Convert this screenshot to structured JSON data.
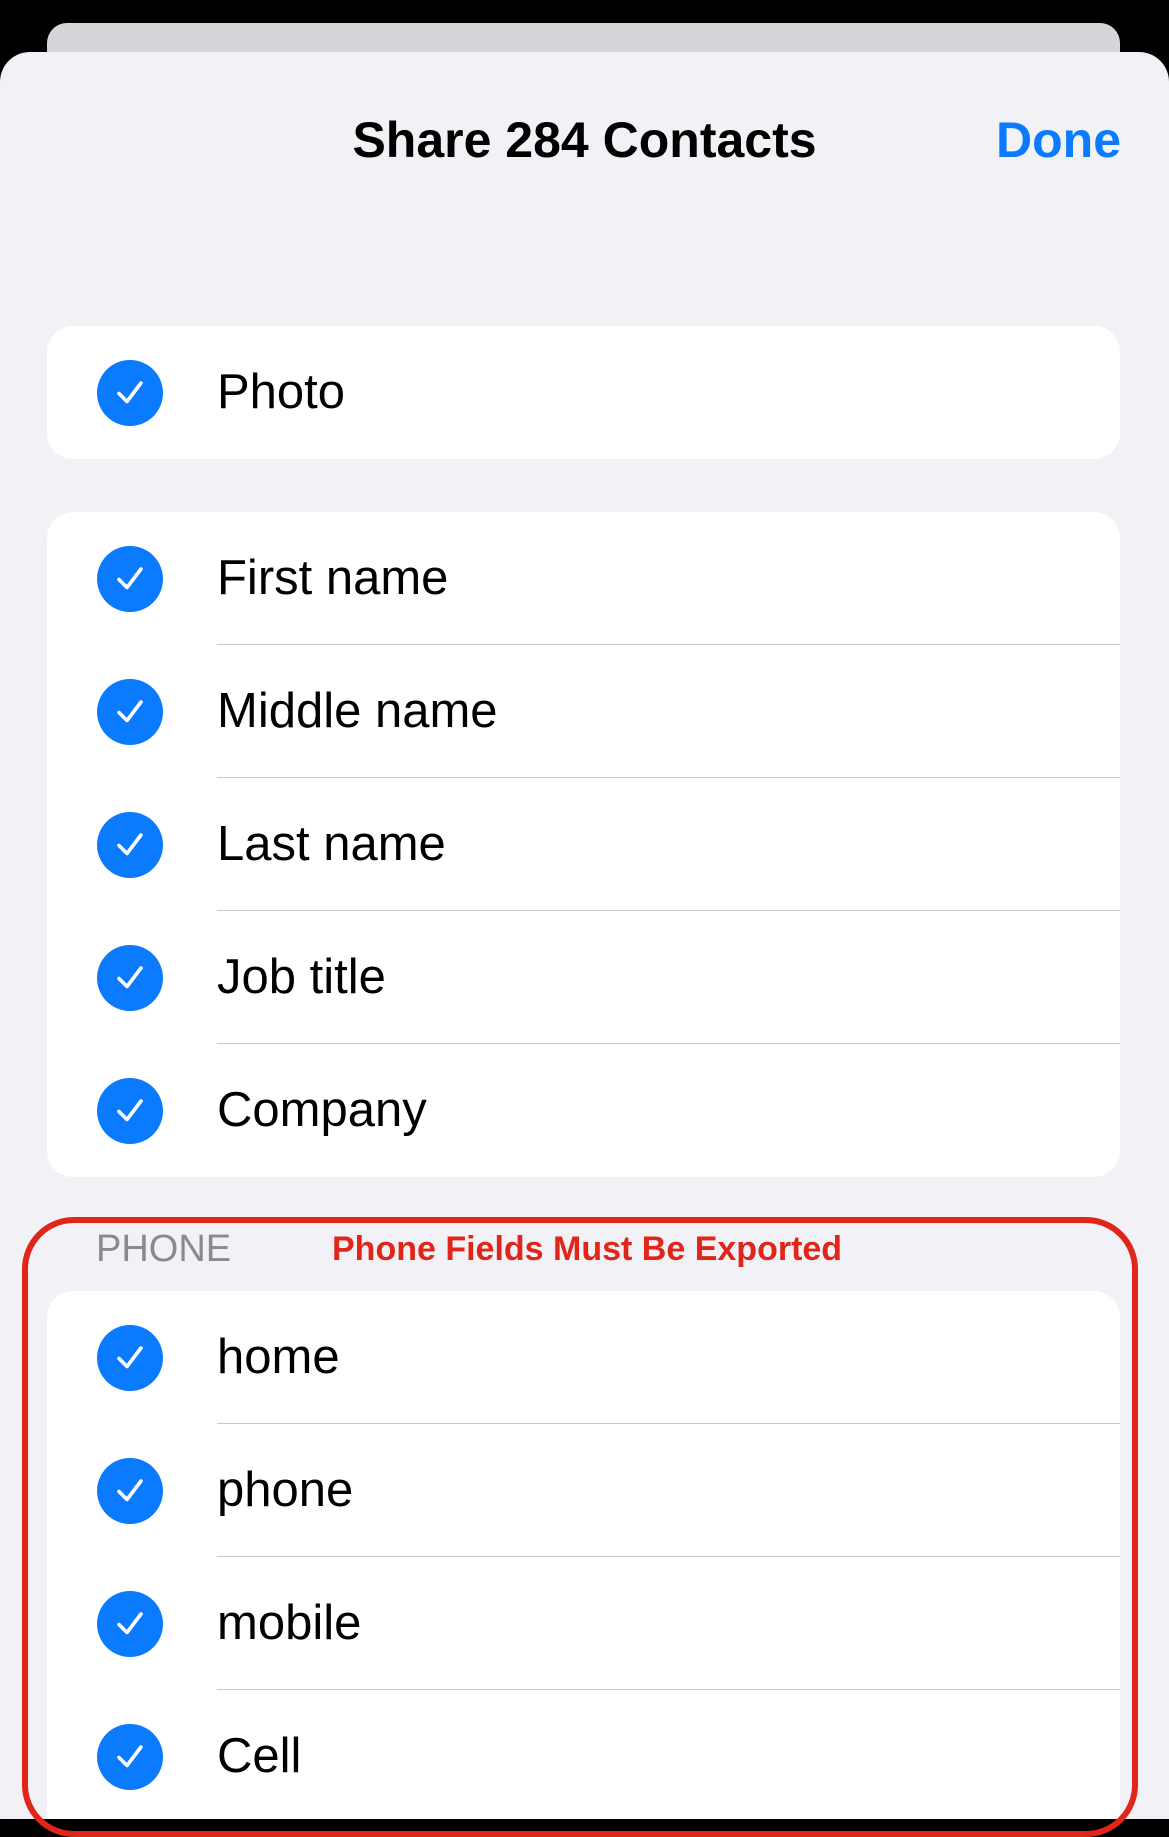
{
  "sheet": {
    "title": "Share 284 Contacts",
    "done_label": "Done"
  },
  "colors": {
    "accent": "#0a7aff",
    "annotation": "#e0251a"
  },
  "groups": {
    "photo": [
      {
        "label": "Photo",
        "checked": true
      }
    ],
    "name": [
      {
        "label": "First name",
        "checked": true
      },
      {
        "label": "Middle name",
        "checked": true
      },
      {
        "label": "Last name",
        "checked": true
      },
      {
        "label": "Job title",
        "checked": true
      },
      {
        "label": "Company",
        "checked": true
      }
    ],
    "phone_header": "PHONE",
    "phone": [
      {
        "label": "home",
        "checked": true
      },
      {
        "label": "phone",
        "checked": true
      },
      {
        "label": "mobile",
        "checked": true
      },
      {
        "label": "Cell",
        "checked": true
      }
    ]
  },
  "annotation": {
    "text": "Phone Fields Must Be Exported"
  }
}
